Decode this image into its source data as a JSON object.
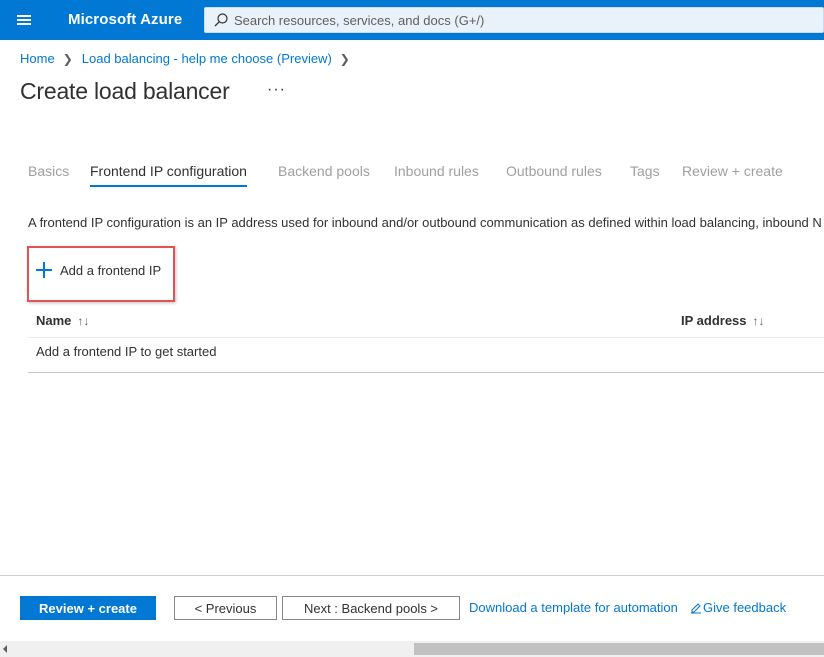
{
  "header": {
    "brand": "Microsoft Azure",
    "search_placeholder": "Search resources, services, and docs (G+/)",
    "accent": "#0078d4"
  },
  "breadcrumb": {
    "items": [
      "Home",
      "Load balancing - help me choose (Preview)"
    ]
  },
  "page": {
    "title": "Create load balancer",
    "more": "···"
  },
  "tabs": [
    {
      "label": "Basics",
      "active": false
    },
    {
      "label": "Frontend IP configuration",
      "active": true
    },
    {
      "label": "Backend pools",
      "active": false
    },
    {
      "label": "Inbound rules",
      "active": false
    },
    {
      "label": "Outbound rules",
      "active": false
    },
    {
      "label": "Tags",
      "active": false
    },
    {
      "label": "Review + create",
      "active": false
    }
  ],
  "content": {
    "description": "A frontend IP configuration is an IP address used for inbound and/or outbound communication as defined within load balancing, inbound N",
    "add_button": "Add a frontend IP",
    "columns": [
      "Name",
      "IP address"
    ],
    "sort_glyph": "↑↓",
    "empty_text": "Add a frontend IP to get started"
  },
  "footer": {
    "review_create": "Review + create",
    "previous": "< Previous",
    "next": "Next : Backend pools >",
    "download_link": "Download a template for automation",
    "feedback": "Give feedback"
  },
  "icons": {
    "menu": "hamburger-icon",
    "search": "search-icon",
    "add": "plus-icon",
    "feedback": "feedback-icon",
    "chevron": "chevron-right-icon"
  },
  "colors": {
    "primary": "#0078d4",
    "highlight_box": "#e35353",
    "inactive_tab": "#a19f9d"
  }
}
